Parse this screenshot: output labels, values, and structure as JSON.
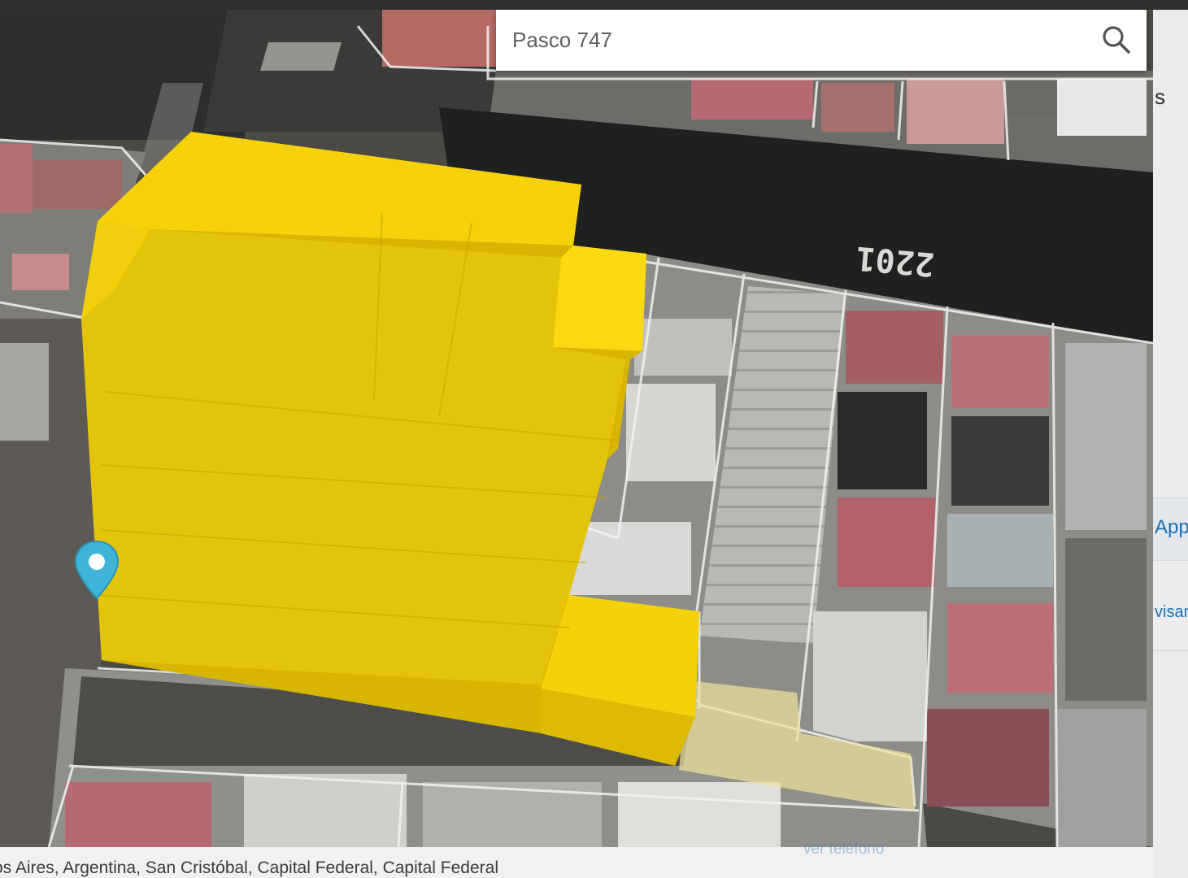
{
  "search": {
    "value": "Pasco 747",
    "icon": "search-icon"
  },
  "map": {
    "road_marking": "2201",
    "marker_icon": "location-pin-icon",
    "marker_color": "#3fb4d8",
    "highlight_color": "#f5d20c"
  },
  "footer": {
    "address": "os Aires, Argentina, San Cristóbal, Capital Federal, Capital Federal",
    "phone_link": "ver teléfono"
  },
  "right_panel": {
    "heading_fragment": "s",
    "button_fragment": "App",
    "link_fragment": "visar"
  }
}
